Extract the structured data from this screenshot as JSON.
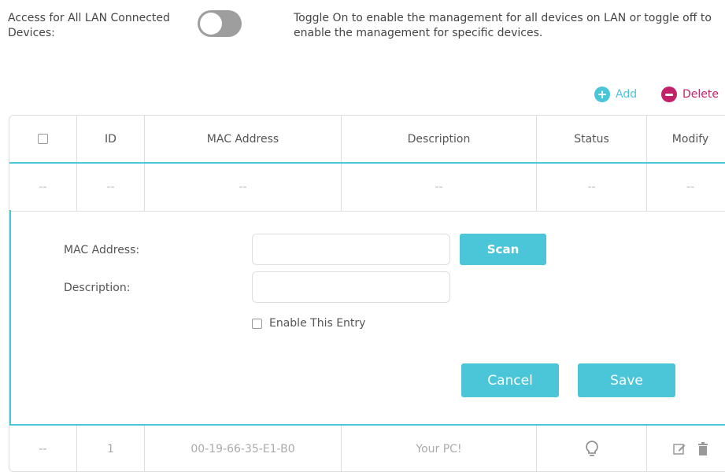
{
  "header": {
    "toggle_label": "Access for All LAN Connected Devices:",
    "toggle_state": "off",
    "toggle_description": "Toggle On to enable the management for all devices on LAN or toggle off to enable the management for specific devices."
  },
  "actions": {
    "add_label": "Add",
    "delete_label": "Delete"
  },
  "table": {
    "columns": [
      "ID",
      "MAC Address",
      "Description",
      "Status",
      "Modify"
    ],
    "empty_row": [
      "--",
      "--",
      "--",
      "--",
      "--",
      "--"
    ],
    "rows": [
      {
        "check": "--",
        "id": "1",
        "mac": "00-19-66-35-E1-B0",
        "description": "Your PC!",
        "status_icon": "bulb-icon",
        "modify_icons": [
          "edit-icon",
          "trash-icon"
        ]
      }
    ]
  },
  "editor": {
    "mac_label": "MAC Address:",
    "mac_value": "",
    "scan_label": "Scan",
    "desc_label": "Description:",
    "desc_value": "",
    "enable_label": "Enable This Entry",
    "cancel_label": "Cancel",
    "save_label": "Save"
  },
  "colors": {
    "accent": "#4ac6d8",
    "delete": "#c4216b"
  }
}
